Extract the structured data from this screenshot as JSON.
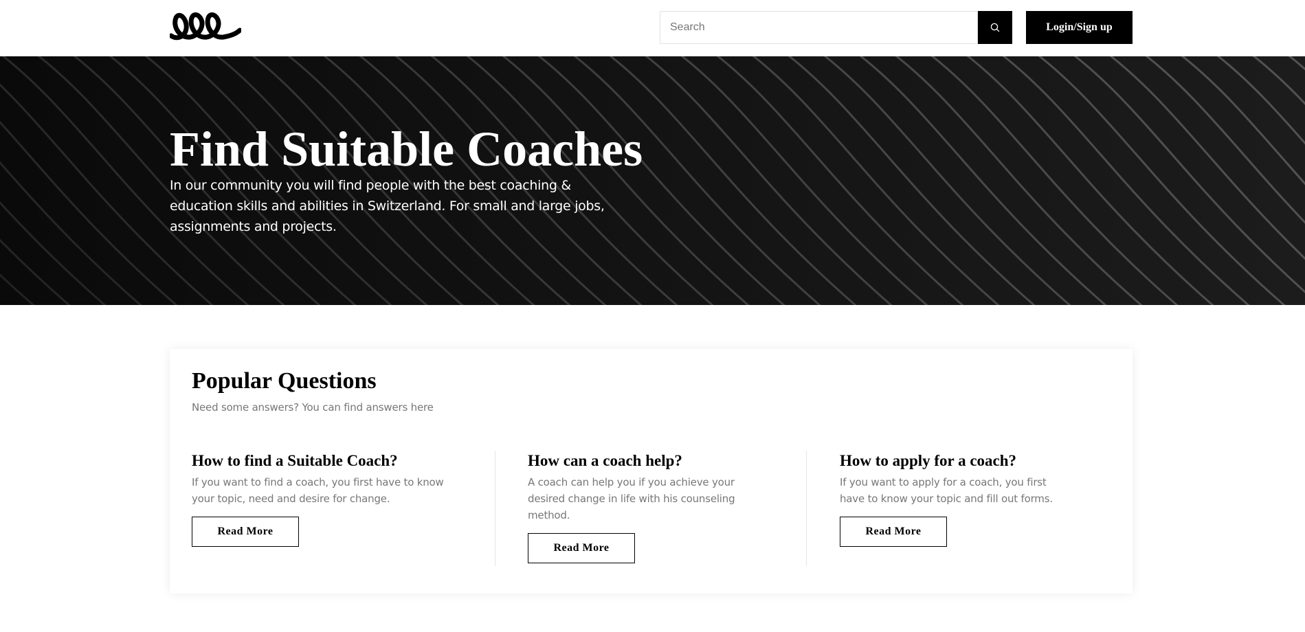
{
  "header": {
    "logo_alt": "lll",
    "search_placeholder": "Search",
    "login_label": "Login/Sign up"
  },
  "hero": {
    "title": "Find Suitable Coaches",
    "subtitle": "In our community you will find people with the best coaching & education skills and abilities in Switzerland. For small and large jobs, assignments and projects."
  },
  "popular": {
    "title": "Popular Questions",
    "subtitle": "Need some answers? You can find answers here",
    "questions": [
      {
        "title": "How to find a Suitable Coach?",
        "text": "If you want to find a coach, you first have to know your topic, need and desire for change.",
        "button": "Read More"
      },
      {
        "title": "How can a coach help?",
        "text": "A coach can help you if you achieve your desired change in life with his counseling method.",
        "button": "Read More"
      },
      {
        "title": "How to apply for a coach?",
        "text": "If you want to apply for a coach, you first have to know your topic and fill out forms.",
        "button": "Read More"
      }
    ]
  },
  "colors": {
    "primary": "#000000",
    "hero_bg": "#101010",
    "muted_text": "#777777"
  }
}
